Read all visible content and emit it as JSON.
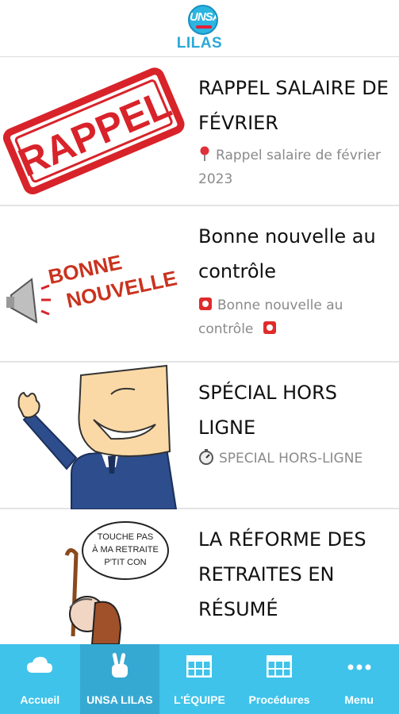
{
  "header": {
    "logo_text": "UNSA",
    "title": "LILAS"
  },
  "articles": [
    {
      "title": "RAPPEL SALAIRE DE FÉVRIER",
      "excerpt_icon": "round-pushpin-icon",
      "excerpt": "Rappel salaire de février 2023",
      "image_text": "RAPPEL"
    },
    {
      "title": "Bonne nouvelle au contrôle",
      "excerpt_icon": "police-light-icon",
      "excerpt": "Bonne nouvelle au contrôle",
      "image_text_1": "BONNE",
      "image_text_2": "NOUVELLE"
    },
    {
      "title": "SPÉCIAL HORS LIGNE",
      "excerpt_icon": "stopwatch-icon",
      "excerpt": "SPECIAL HORS-LIGNE"
    },
    {
      "title": "LA RÉFORME DES RETRAITES EN RÉSUMÉ",
      "image_text_1": "TOUCHE PAS",
      "image_text_2": "À MA RETRAITE",
      "image_text_3": "P'TIT CON"
    }
  ],
  "nav": [
    {
      "label": "Accueil",
      "icon": "cloud-icon",
      "active": false
    },
    {
      "label": "UNSA LILAS",
      "icon": "peace-hand-icon",
      "active": true
    },
    {
      "label": "L'ÉQUIPE",
      "icon": "table-icon",
      "active": false
    },
    {
      "label": "Procédures",
      "icon": "table-icon",
      "active": false
    },
    {
      "label": "Menu",
      "icon": "ellipsis-icon",
      "active": false
    }
  ],
  "colors": {
    "accent": "#2aa8d8",
    "nav_bg": "#3fc3ea",
    "nav_active": "#36a9d2",
    "stamp_red": "#d8232a"
  }
}
